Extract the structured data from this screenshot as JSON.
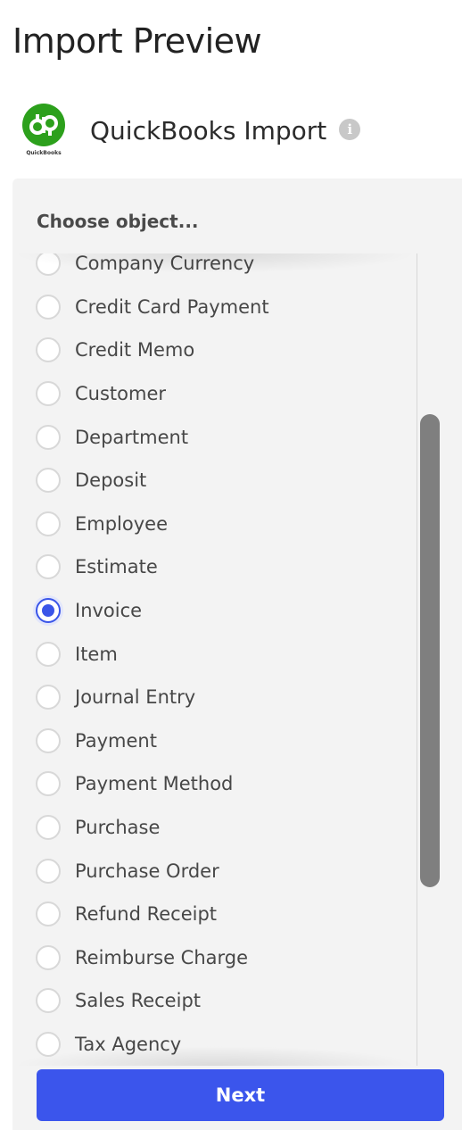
{
  "page": {
    "title": "Import Preview"
  },
  "header": {
    "logo_text": "QuickBooks",
    "logo_letters": "qb",
    "title": "QuickBooks Import",
    "info_icon": "info-icon",
    "info_glyph": "i"
  },
  "chooser": {
    "heading": "Choose object...",
    "selected": "Invoice",
    "options": [
      {
        "label": "Company Currency",
        "checked": false
      },
      {
        "label": "Credit Card Payment",
        "checked": false
      },
      {
        "label": "Credit Memo",
        "checked": false
      },
      {
        "label": "Customer",
        "checked": false
      },
      {
        "label": "Department",
        "checked": false
      },
      {
        "label": "Deposit",
        "checked": false
      },
      {
        "label": "Employee",
        "checked": false
      },
      {
        "label": "Estimate",
        "checked": false
      },
      {
        "label": "Invoice",
        "checked": true
      },
      {
        "label": "Item",
        "checked": false
      },
      {
        "label": "Journal Entry",
        "checked": false
      },
      {
        "label": "Payment",
        "checked": false
      },
      {
        "label": "Payment Method",
        "checked": false
      },
      {
        "label": "Purchase",
        "checked": false
      },
      {
        "label": "Purchase Order",
        "checked": false
      },
      {
        "label": "Refund Receipt",
        "checked": false
      },
      {
        "label": "Reimburse Charge",
        "checked": false
      },
      {
        "label": "Sales Receipt",
        "checked": false
      },
      {
        "label": "Tax Agency",
        "checked": false
      }
    ]
  },
  "footer": {
    "next_label": "Next"
  },
  "colors": {
    "accent": "#3b55ec",
    "brand_green": "#2ca01c",
    "panel_bg": "#f3f3f3",
    "scroll_thumb": "#7f7f7f"
  }
}
